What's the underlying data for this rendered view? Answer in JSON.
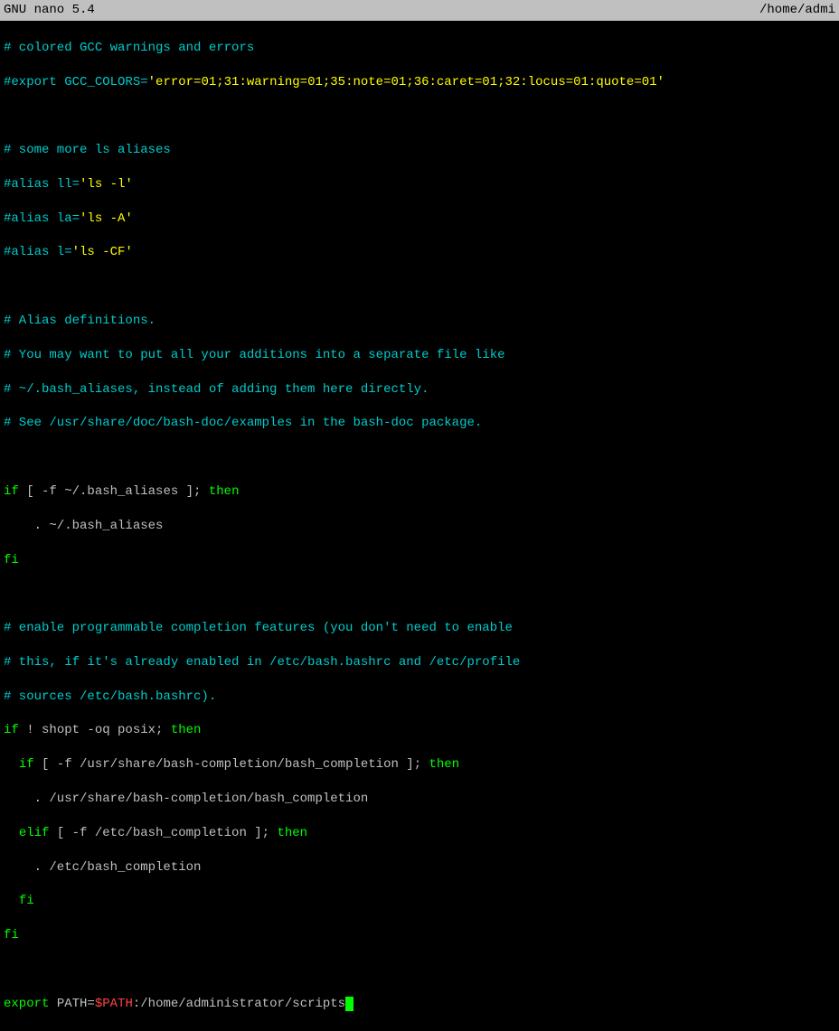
{
  "titlebar": {
    "app": "  GNU nano 5.4",
    "filepath": "/home/admi"
  },
  "lines": {
    "l1": "# colored GCC warnings and errors",
    "l2_prefix": "#export GCC_COLORS=",
    "l2_string": "'error=01;31:warning=01;35:note=01;36:caret=01;32:locus=01:quote=01'",
    "l3": "",
    "l4": "# some more ls aliases",
    "l5_prefix": "#alias ll=",
    "l5_string": "'ls -l'",
    "l6_prefix": "#alias la=",
    "l6_string": "'ls -A'",
    "l7_prefix": "#alias l=",
    "l7_string": "'ls -CF'",
    "l8": "",
    "l9": "# Alias definitions.",
    "l10": "# You may want to put all your additions into a separate file like",
    "l11": "# ~/.bash_aliases, instead of adding them here directly.",
    "l12": "# See /usr/share/doc/bash-doc/examples in the bash-doc package.",
    "l13": "",
    "l14_if": "if",
    "l14_cond": " [ -f ~/.bash_aliases ]; ",
    "l14_then": "then",
    "l15": "    . ~/.bash_aliases",
    "l16": "fi",
    "l17": "",
    "l18": "# enable programmable completion features (you don't need to enable",
    "l19": "# this, if it's already enabled in /etc/bash.bashrc and /etc/profile",
    "l20": "# sources /etc/bash.bashrc).",
    "l21_if": "if",
    "l21_cond": " ! shopt -oq posix; ",
    "l21_then": "then",
    "l22_indent": "  ",
    "l22_if": "if",
    "l22_cond": " [ -f /usr/share/bash-completion/bash_completion ]; ",
    "l22_then": "then",
    "l23": "    . /usr/share/bash-completion/bash_completion",
    "l24_indent": "  ",
    "l24_elif": "elif",
    "l24_cond": " [ -f /etc/bash_completion ]; ",
    "l24_then": "then",
    "l25": "    . /etc/bash_completion",
    "l26_indent": "  ",
    "l26_fi": "fi",
    "l27": "fi",
    "l28": "",
    "l29_export": "export",
    "l29_path": " PATH=",
    "l29_var": "$PATH",
    "l29_rest": ":/home/administrator/scripts"
  }
}
